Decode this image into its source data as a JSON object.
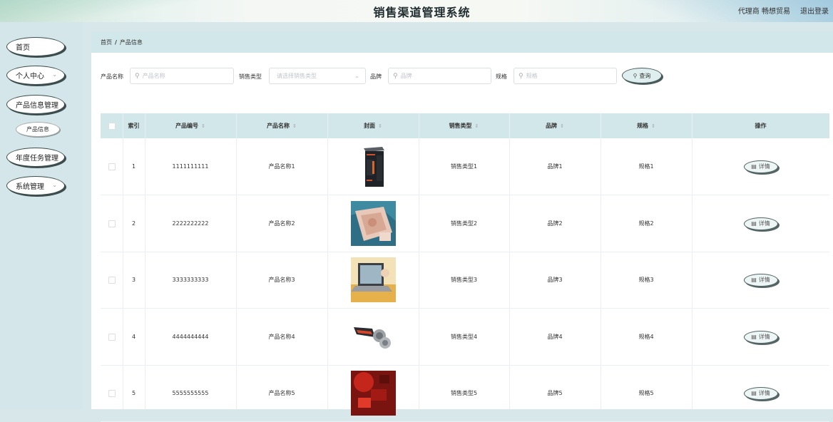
{
  "header": {
    "title": "销售渠道管理系统",
    "user": "代理商 畅想贸易",
    "logout": "退出登录"
  },
  "sidebar": {
    "items": [
      {
        "label": "首页"
      },
      {
        "label": "个人中心"
      },
      {
        "label": "产品信息管理"
      },
      {
        "label": "产品信息"
      },
      {
        "label": "年度任务管理"
      },
      {
        "label": "系统管理"
      }
    ]
  },
  "breadcrumb": {
    "home": "首页",
    "separator": "/",
    "current": "产品信息"
  },
  "search": {
    "name_label": "产品名称",
    "name_placeholder": "产品名称",
    "type_label": "销售类型",
    "type_placeholder": "请选择销售类型",
    "brand_label": "品牌",
    "brand_placeholder": "品牌",
    "spec_label": "规格",
    "spec_placeholder": "规格",
    "query_button": "查询"
  },
  "table": {
    "headers": {
      "index": "索引",
      "code": "产品编号",
      "name": "产品名称",
      "cover": "封面",
      "type": "销售类型",
      "brand": "品牌",
      "spec": "规格",
      "action": "操作"
    },
    "detail_label": "详情",
    "rows": [
      {
        "index": "1",
        "code": "1111111111",
        "name": "产品名称1",
        "type": "销售类型1",
        "brand": "品牌1",
        "spec": "规格1"
      },
      {
        "index": "2",
        "code": "2222222222",
        "name": "产品名称2",
        "type": "销售类型2",
        "brand": "品牌2",
        "spec": "规格2"
      },
      {
        "index": "3",
        "code": "3333333333",
        "name": "产品名称3",
        "type": "销售类型3",
        "brand": "品牌3",
        "spec": "规格3"
      },
      {
        "index": "4",
        "code": "4444444444",
        "name": "产品名称4",
        "type": "销售类型4",
        "brand": "品牌4",
        "spec": "规格4"
      },
      {
        "index": "5",
        "code": "5555555555",
        "name": "产品名称5",
        "type": "销售类型5",
        "brand": "品牌5",
        "spec": "规格5"
      }
    ]
  },
  "colors": {
    "accent": "#d2e7ea",
    "sidebar_bg": "#d4e6e9",
    "button_border": "#3d4d4e"
  }
}
